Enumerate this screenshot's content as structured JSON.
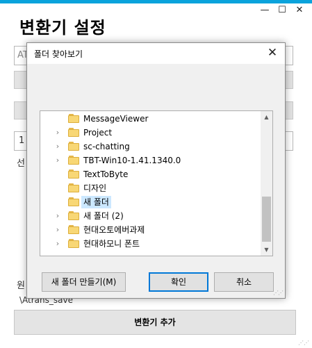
{
  "window": {
    "title": "변환기 설정",
    "minimize": "—",
    "maximize": "☐",
    "close": "✕"
  },
  "background_form": {
    "field1_text": "AT",
    "field3_text": "1",
    "label_sel": "선",
    "label_src": "원",
    "path_text": "\\Atrans_save",
    "add_button": "변환기 추가"
  },
  "dialog": {
    "title": "폴더 찾아보기",
    "close": "✕",
    "tree_items": [
      {
        "label": "MessageViewer",
        "has_children": false,
        "selected": false
      },
      {
        "label": "Project",
        "has_children": true,
        "selected": false
      },
      {
        "label": "sc-chatting",
        "has_children": true,
        "selected": false
      },
      {
        "label": "TBT-Win10-1.41.1340.0",
        "has_children": true,
        "selected": false
      },
      {
        "label": "TextToByte",
        "has_children": false,
        "selected": false
      },
      {
        "label": "디자인",
        "has_children": false,
        "selected": false
      },
      {
        "label": "새 폴더",
        "has_children": false,
        "selected": true
      },
      {
        "label": "새 폴더 (2)",
        "has_children": true,
        "selected": false
      },
      {
        "label": "현대오토에버과제",
        "has_children": true,
        "selected": false
      },
      {
        "label": "현대하모니 폰트",
        "has_children": true,
        "selected": false
      }
    ],
    "scroll_up": "▲",
    "scroll_down": "▼",
    "new_folder_button": "새 폴더 만들기(M)",
    "ok_button": "확인",
    "cancel_button": "취소"
  },
  "icons": {
    "folder": "folder-icon",
    "expand": "chevron-right-icon"
  },
  "colors": {
    "title_stripe": "#0aa3dc",
    "selection": "#cce8ff",
    "default_button_border": "#0078d7",
    "folder": "#f8d775"
  }
}
